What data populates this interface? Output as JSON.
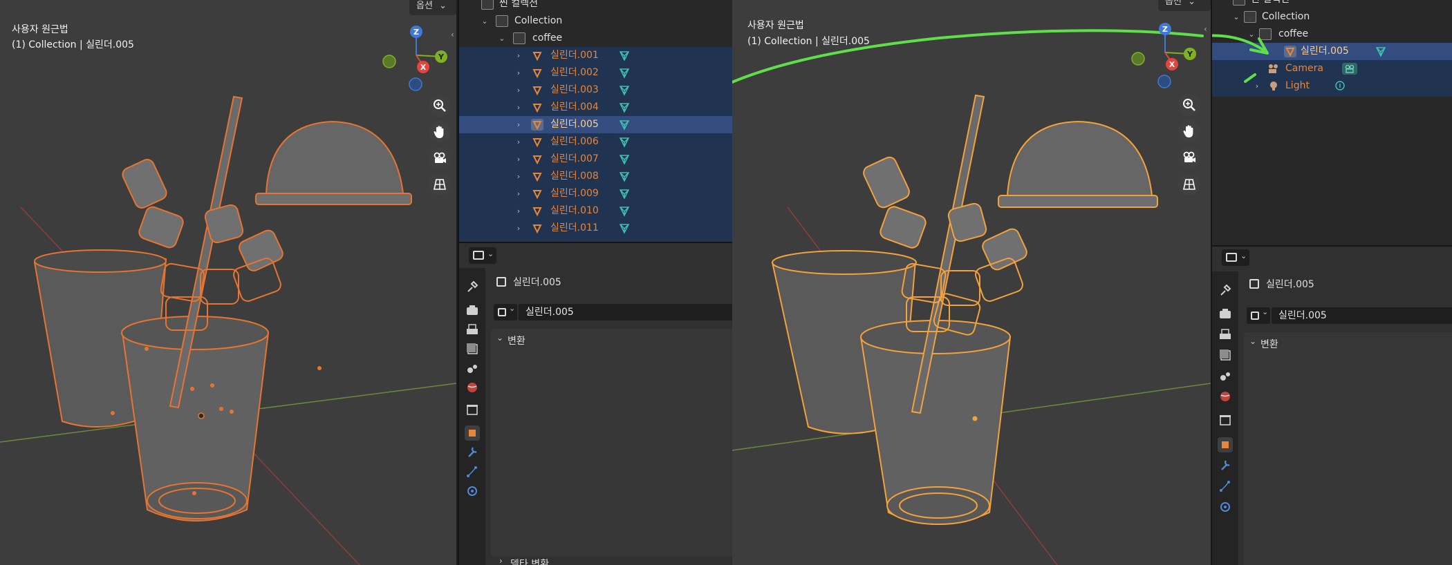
{
  "left": {
    "viewport": {
      "mode": "사용자 원근법",
      "context": "(1) Collection | 실린더.005",
      "options_label": "옵션"
    },
    "outliner": {
      "scene_collection": "씬 컬렉션",
      "collection": "Collection",
      "coffee": "coffee",
      "items": [
        "실린더.001",
        "실린더.002",
        "실린더.003",
        "실린더.004",
        "실린더.005",
        "실린더.006",
        "실린더.007",
        "실린더.008",
        "실린더.009",
        "실린더.010",
        "실린더.011"
      ],
      "active_item": "실린더.005"
    },
    "properties": {
      "object_name": "실린더.005",
      "name_field": "실린더.005",
      "transform_panel": "변환",
      "delta_panel": "델타 변환"
    }
  },
  "right": {
    "viewport": {
      "mode": "사용자 원근법",
      "context": "(1) Collection | 실린더.005",
      "options_label": "옵션"
    },
    "outliner": {
      "scene_collection": "씬 컬렉션",
      "collection": "Collection",
      "coffee": "coffee",
      "active_item": "실린더.005",
      "camera": "Camera",
      "light": "Light"
    },
    "properties": {
      "object_name": "실린더.005",
      "name_field": "실린더.005",
      "transform_panel": "변환"
    }
  },
  "gizmo": {
    "x": "X",
    "y": "Y",
    "z": "Z"
  },
  "colors": {
    "viewport_bg": "#3d3d3d",
    "selected_outline": "#e8752f",
    "active_outline": "#f5a23c",
    "outliner_selected": "#203351",
    "outliner_active": "#334d80",
    "arrow": "#5fe04a",
    "axis_x": "#e4463f",
    "axis_y": "#7fb21f",
    "axis_z": "#3f7ad9"
  },
  "icons": [
    "zoom-icon",
    "hand-icon",
    "camera-icon",
    "grid-icon",
    "mesh-data-icon",
    "cylinder-object-icon",
    "collection-icon",
    "tool-icon",
    "render-icon",
    "output-icon",
    "view-layer-icon",
    "scene-icon",
    "world-icon",
    "collection-prop-icon",
    "object-icon",
    "modifier-icon",
    "particles-icon",
    "physics-icon"
  ]
}
